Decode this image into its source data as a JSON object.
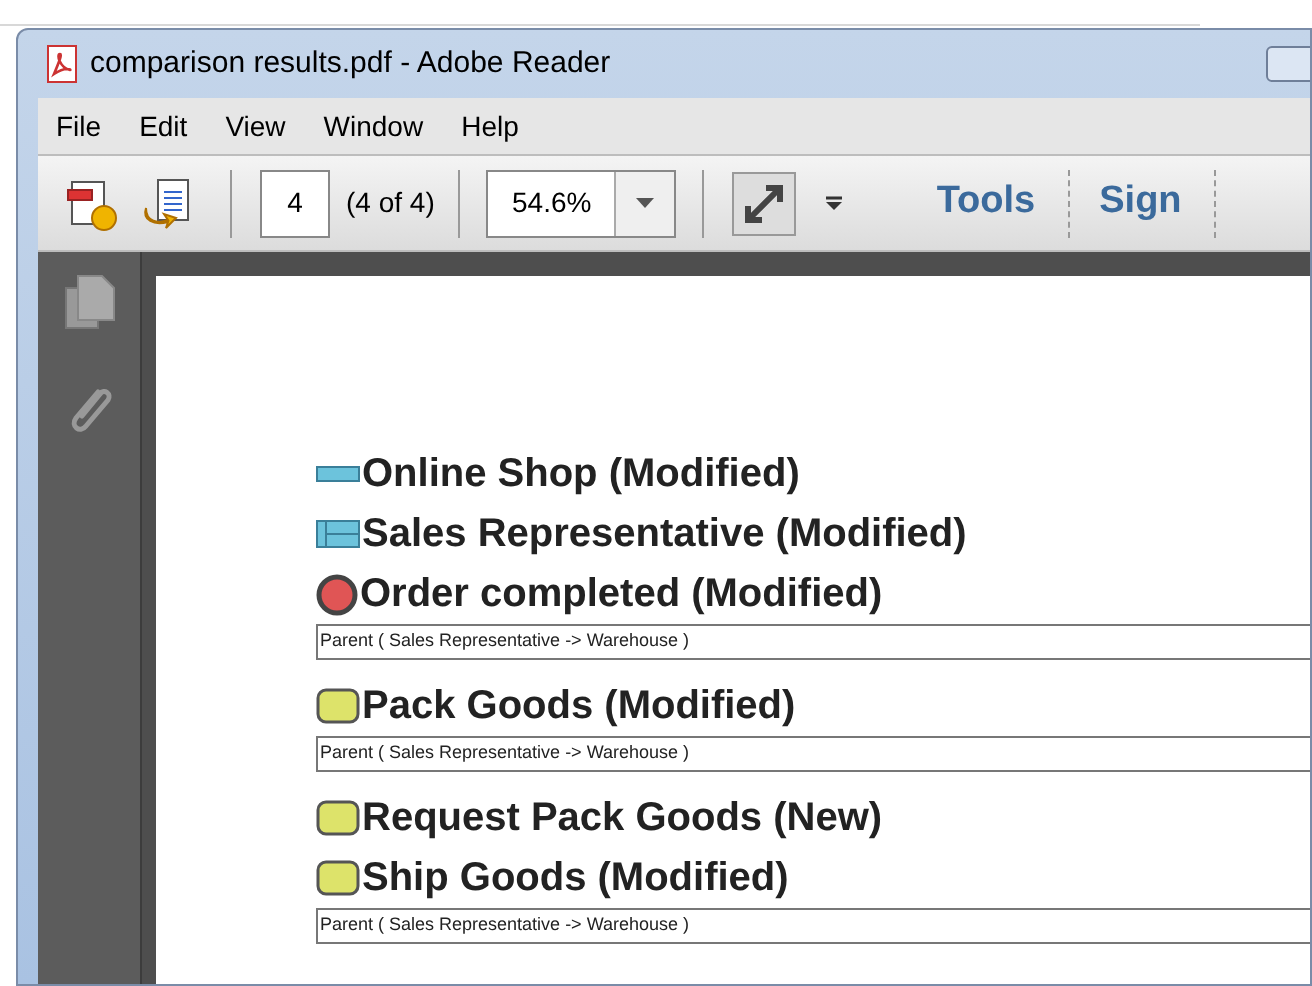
{
  "window": {
    "title": "comparison results.pdf - Adobe Reader"
  },
  "menu": [
    "File",
    "Edit",
    "View",
    "Window",
    "Help"
  ],
  "toolbar": {
    "page": "4",
    "page_count": "(4 of 4)",
    "zoom": "54.6%",
    "tools": "Tools",
    "sign": "Sign"
  },
  "entries": [
    {
      "kind": "pool",
      "label": "Online Shop (Modified)"
    },
    {
      "kind": "lane",
      "label": "Sales Representative (Modified)"
    },
    {
      "kind": "end-event",
      "label": "Order completed (Modified)",
      "detail": "Parent ( Sales Representative -> Warehouse )"
    },
    {
      "kind": "task",
      "label": "Pack Goods (Modified)",
      "detail": "Parent ( Sales Representative -> Warehouse )"
    },
    {
      "kind": "task",
      "label": "Request Pack Goods (New)"
    },
    {
      "kind": "task",
      "label": "Ship Goods (Modified)",
      "detail": "Parent ( Sales Representative -> Warehouse )"
    }
  ]
}
